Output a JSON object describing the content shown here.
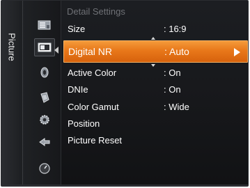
{
  "tab": {
    "label": "Picture"
  },
  "icons": [
    {
      "name": "picture-menu-icon",
      "label": ""
    },
    {
      "name": "picture-active-icon",
      "label": ""
    },
    {
      "name": "sound-icon",
      "label": ""
    },
    {
      "name": "channel-icon",
      "label": ""
    },
    {
      "name": "setup-icon",
      "label": ""
    },
    {
      "name": "input-icon",
      "label": ""
    },
    {
      "name": "support-icon",
      "label": ""
    }
  ],
  "menu": {
    "title": "Detail Settings",
    "items": [
      {
        "label": "Size",
        "value": ": 16:9"
      },
      {
        "label": "Digital NR",
        "value": ": Auto"
      },
      {
        "label": "Active Color",
        "value": ": On"
      },
      {
        "label": "DNIe",
        "value": ": On"
      },
      {
        "label": "Color Gamut",
        "value": ": Wide"
      },
      {
        "label": "Position",
        "value": ""
      },
      {
        "label": "Picture Reset",
        "value": ""
      }
    ]
  },
  "colors": {
    "highlight": "#e8781a",
    "background": "#17181b",
    "text": "#ffffff",
    "title_text": "#6f7176"
  }
}
